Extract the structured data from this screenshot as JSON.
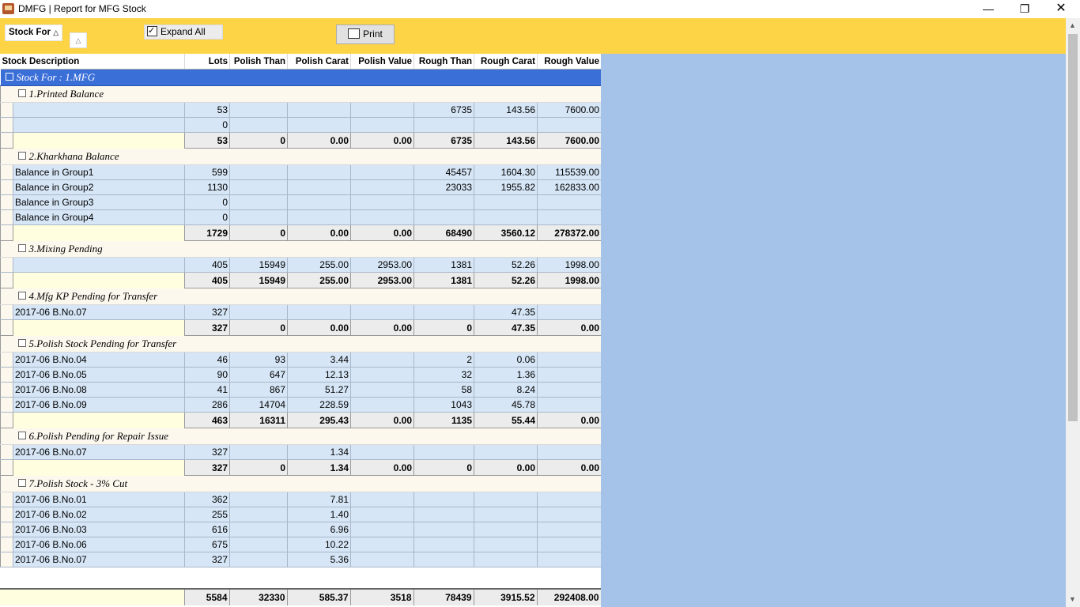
{
  "window": {
    "title": "DMFG | Report for MFG Stock"
  },
  "toolbar": {
    "group_label": "Stock For",
    "expand_label": "Expand All",
    "print_label": "Print"
  },
  "columns": [
    "Stock Description",
    "Lots",
    "Polish Than",
    "Polish Carat",
    "Polish Value",
    "Rough Than",
    "Rough Carat",
    "Rough Value"
  ],
  "top_group": "Stock For : 1.MFG",
  "groups": [
    {
      "title": "1.Printed Balance",
      "rows": [
        [
          "",
          "53",
          "",
          "",
          "",
          "6735",
          "143.56",
          "7600.00"
        ],
        [
          "",
          "0",
          "",
          "",
          "",
          "",
          "",
          ""
        ]
      ],
      "totals": [
        "53",
        "0",
        "0.00",
        "0.00",
        "6735",
        "143.56",
        "7600.00"
      ]
    },
    {
      "title": "2.Kharkhana Balance",
      "rows": [
        [
          "Balance in Group1",
          "599",
          "",
          "",
          "",
          "45457",
          "1604.30",
          "115539.00"
        ],
        [
          "Balance in Group2",
          "1130",
          "",
          "",
          "",
          "23033",
          "1955.82",
          "162833.00"
        ],
        [
          "Balance in Group3",
          "0",
          "",
          "",
          "",
          "",
          "",
          ""
        ],
        [
          "Balance in Group4",
          "0",
          "",
          "",
          "",
          "",
          "",
          ""
        ]
      ],
      "totals": [
        "1729",
        "0",
        "0.00",
        "0.00",
        "68490",
        "3560.12",
        "278372.00"
      ]
    },
    {
      "title": "3.Mixing Pending",
      "rows": [
        [
          "",
          "405",
          "15949",
          "255.00",
          "2953.00",
          "1381",
          "52.26",
          "1998.00"
        ]
      ],
      "totals": [
        "405",
        "15949",
        "255.00",
        "2953.00",
        "1381",
        "52.26",
        "1998.00"
      ]
    },
    {
      "title": "4.Mfg KP Pending for Transfer",
      "rows": [
        [
          "2017-06 B.No.07",
          "327",
          "",
          "",
          "",
          "",
          "47.35",
          ""
        ]
      ],
      "totals": [
        "327",
        "0",
        "0.00",
        "0.00",
        "0",
        "47.35",
        "0.00"
      ]
    },
    {
      "title": "5.Polish Stock Pending for Transfer",
      "rows": [
        [
          "2017-06 B.No.04",
          "46",
          "93",
          "3.44",
          "",
          "2",
          "0.06",
          ""
        ],
        [
          "2017-06 B.No.05",
          "90",
          "647",
          "12.13",
          "",
          "32",
          "1.36",
          ""
        ],
        [
          "2017-06 B.No.08",
          "41",
          "867",
          "51.27",
          "",
          "58",
          "8.24",
          ""
        ],
        [
          "2017-06 B.No.09",
          "286",
          "14704",
          "228.59",
          "",
          "1043",
          "45.78",
          ""
        ]
      ],
      "totals": [
        "463",
        "16311",
        "295.43",
        "0.00",
        "1135",
        "55.44",
        "0.00"
      ]
    },
    {
      "title": "6.Polish Pending for Repair Issue",
      "rows": [
        [
          "2017-06 B.No.07",
          "327",
          "",
          "1.34",
          "",
          "",
          "",
          ""
        ]
      ],
      "totals": [
        "327",
        "0",
        "1.34",
        "0.00",
        "0",
        "0.00",
        "0.00"
      ]
    },
    {
      "title": "7.Polish Stock - 3% Cut",
      "rows": [
        [
          "2017-06 B.No.01",
          "362",
          "",
          "7.81",
          "",
          "",
          "",
          ""
        ],
        [
          "2017-06 B.No.02",
          "255",
          "",
          "1.40",
          "",
          "",
          "",
          ""
        ],
        [
          "2017-06 B.No.03",
          "616",
          "",
          "6.96",
          "",
          "",
          "",
          ""
        ],
        [
          "2017-06 B.No.06",
          "675",
          "",
          "10.22",
          "",
          "",
          "",
          ""
        ],
        [
          "2017-06 B.No.07",
          "327",
          "",
          "5.36",
          "",
          "",
          "",
          ""
        ]
      ],
      "totals": null
    }
  ],
  "grand_totals": [
    "5584",
    "32330",
    "585.37",
    "3518",
    "78439",
    "3915.52",
    "292408.00"
  ]
}
